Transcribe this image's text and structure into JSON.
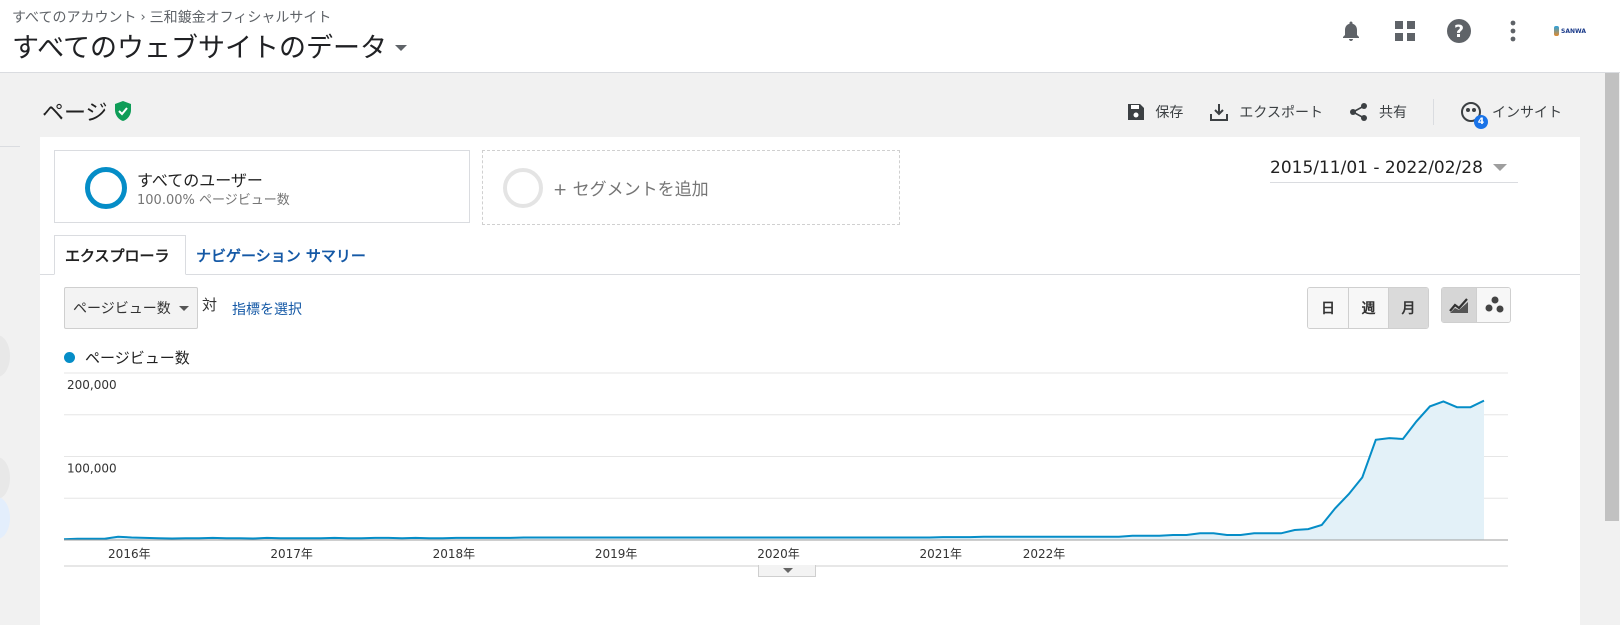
{
  "header": {
    "breadcrumb": [
      "すべてのアカウント",
      "三和鍍金オフィシャルサイト"
    ],
    "breadcrumb_sep": "›",
    "view_title": "すべてのウェブサイトのデータ",
    "icons": [
      "bell-icon",
      "apps-grid-icon",
      "help-icon",
      "more-vert-icon"
    ],
    "logo_text": "SANWA"
  },
  "page": {
    "title": "ページ",
    "actions": {
      "save": "保存",
      "export": "エクスポート",
      "share": "共有",
      "insight": "インサイト",
      "insight_badge": "4"
    }
  },
  "segments": {
    "active_name": "すべてのユーザー",
    "active_sub": "100.00% ページビュー数",
    "add_label": "+ セグメントを追加"
  },
  "date_range": "2015/11/01 - 2022/02/28",
  "tabs": [
    {
      "label": "エクスプローラ"
    },
    {
      "label": "ナビゲーション サマリー"
    }
  ],
  "controls": {
    "metric": "ページビュー数",
    "vs": "対",
    "pick_metric": "指標を選択",
    "granularity": [
      "日",
      "週",
      "月"
    ],
    "selected_granularity": "月"
  },
  "colors": {
    "accent": "#058dc7",
    "fill": "#e3f1f8",
    "link": "#1559a6"
  },
  "chart_data": {
    "type": "area",
    "title": "",
    "series": [
      {
        "name": "ページビュー数",
        "values": [
          1000,
          1500,
          1500,
          1500,
          4000,
          3000,
          2500,
          2000,
          1800,
          2000,
          2000,
          2500,
          2000,
          2000,
          1800,
          2500,
          2000,
          2000,
          2000,
          2000,
          2500,
          2000,
          2000,
          2500,
          2500,
          2000,
          2500,
          2000,
          2000,
          2500,
          2500,
          2500,
          2500,
          2500,
          3000,
          3000,
          3000,
          3000,
          3000,
          3000,
          3000,
          3000,
          3000,
          3000,
          3000,
          3000,
          3000,
          3000,
          3000,
          3000,
          3000,
          3000,
          3000,
          3000,
          3000,
          3000,
          3000,
          3000,
          3000,
          3000,
          3000,
          3000,
          3000,
          3000,
          3000,
          3500,
          3500,
          3500,
          4000,
          4000,
          4000,
          4000,
          4000,
          4000,
          4000,
          4000,
          4000,
          4000,
          4000,
          5000,
          5000,
          5000,
          6000,
          6000,
          8000,
          8000,
          6000,
          6000,
          8000,
          8000,
          8000,
          12000,
          13000,
          18000,
          38000,
          55000,
          75000,
          120000,
          122000,
          121000,
          142000,
          160000,
          166000,
          159000,
          159000,
          167000
        ]
      }
    ],
    "x_tick_labels": [
      "2016年",
      "2017年",
      "2018年",
      "2019年",
      "2020年",
      "2021年",
      "2022年"
    ],
    "y_tick_labels": [
      "200,000",
      "100,000"
    ],
    "y_ticks": [
      200000,
      100000
    ],
    "ylim": [
      0,
      200000
    ],
    "x_start": "2015/11/01",
    "x_end": "2022/02/28",
    "grid": true,
    "legend": "top-left"
  }
}
